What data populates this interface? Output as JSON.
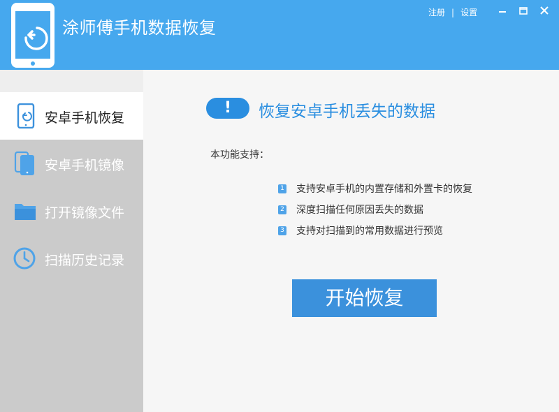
{
  "app": {
    "title": "涂师傅手机数据恢复",
    "register_link": "注册",
    "link_separator": "|",
    "settings_link": "设置"
  },
  "sidebar": {
    "items": [
      {
        "label": "安卓手机恢复",
        "icon": "phone-restore-icon",
        "active": true
      },
      {
        "label": "安卓手机镜像",
        "icon": "phone-mirror-icon",
        "active": false
      },
      {
        "label": "打开镜像文件",
        "icon": "folder-icon",
        "active": false
      },
      {
        "label": "扫描历史记录",
        "icon": "clock-icon",
        "active": false
      }
    ]
  },
  "main": {
    "title": "恢复安卓手机丢失的数据",
    "info_mark": "!",
    "support_label": "本功能支持：",
    "features": [
      {
        "num": "1",
        "text": "支持安卓手机的内置存储和外置卡的恢复"
      },
      {
        "num": "2",
        "text": "深度扫描任何原因丢失的数据"
      },
      {
        "num": "3",
        "text": "支持对扫描到的常用数据进行预览"
      }
    ],
    "start_button": "开始恢复"
  },
  "colors": {
    "header_bg": "#46a8ee",
    "accent": "#2a8ee0",
    "button_bg": "#3b91dc",
    "sidebar_bg": "#cbcbcb",
    "sidebar_active_bg": "#ffffff"
  }
}
